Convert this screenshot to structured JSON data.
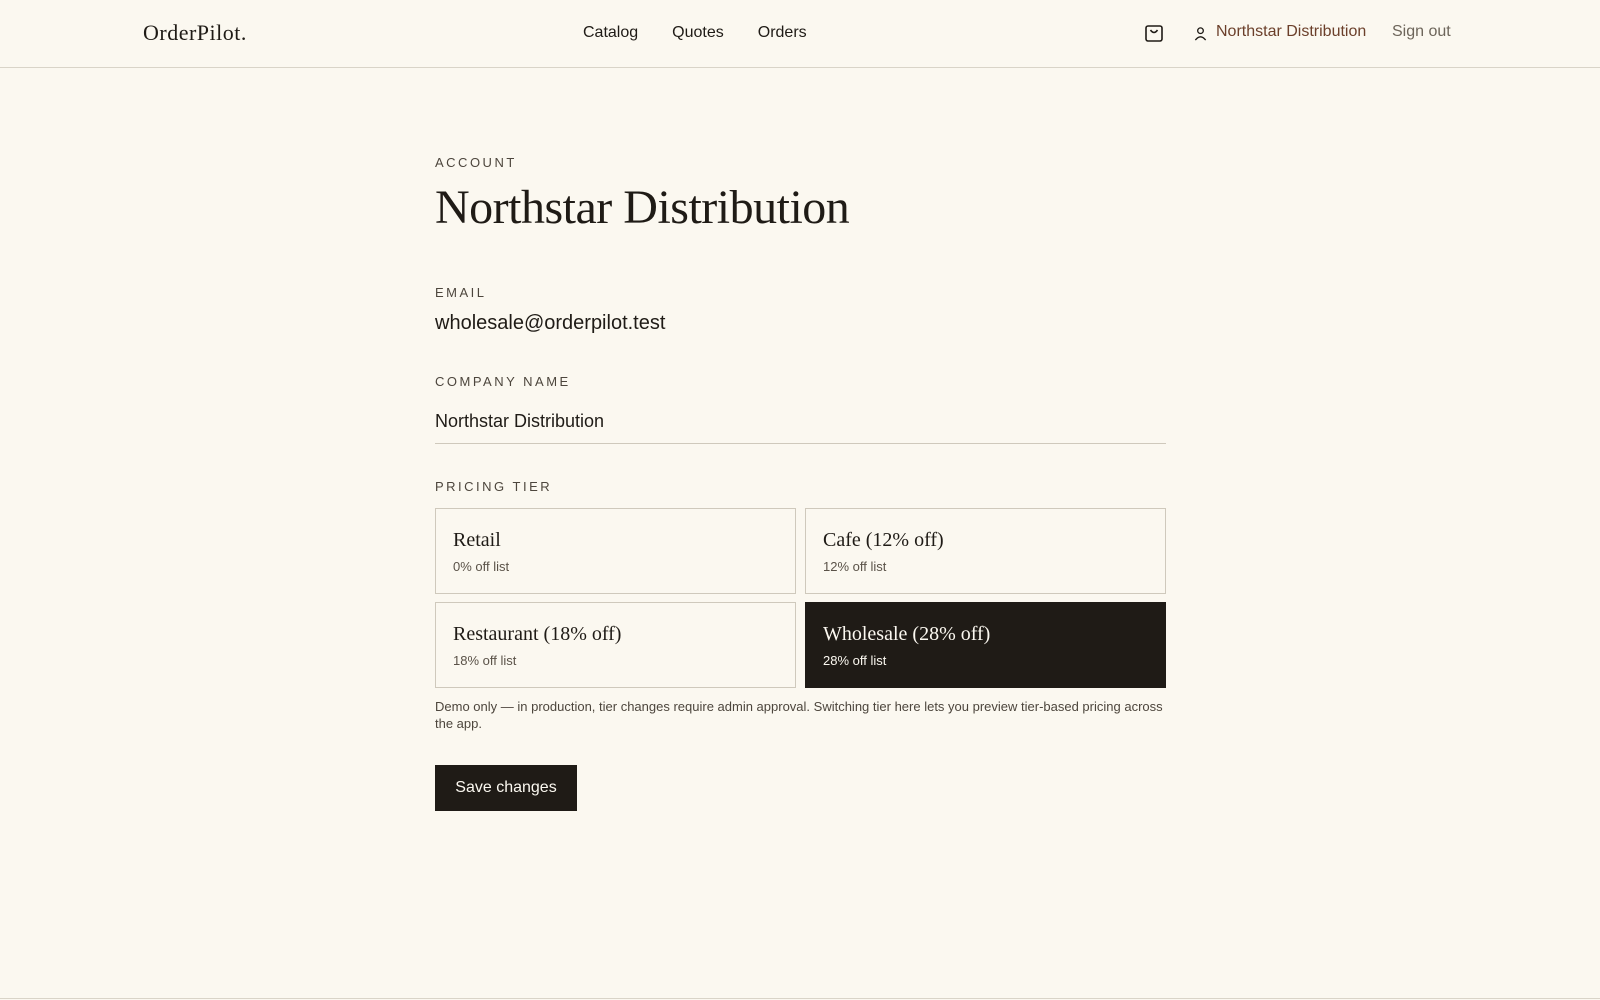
{
  "header": {
    "logo": "OrderPilot.",
    "nav": [
      "Catalog",
      "Quotes",
      "Orders"
    ],
    "cart_icon": "shopping-bag-icon",
    "account_icon": "user-icon",
    "account_name": "Northstar Distribution",
    "signout_label": "Sign out"
  },
  "account": {
    "eyebrow": "ACCOUNT",
    "title": "Northstar Distribution",
    "email_label": "EMAIL",
    "email": "wholesale@orderpilot.test",
    "company_label": "COMPANY NAME",
    "company_value": "Northstar Distribution",
    "tier_label": "PRICING TIER",
    "tiers": [
      {
        "name": "Retail",
        "sub": "0% off list",
        "selected": false
      },
      {
        "name": "Cafe (12% off)",
        "sub": "12% off list",
        "selected": false
      },
      {
        "name": "Restaurant (18% off)",
        "sub": "18% off list",
        "selected": false
      },
      {
        "name": "Wholesale (28% off)",
        "sub": "28% off list",
        "selected": true
      }
    ],
    "note": "Demo only — in production, tier changes require admin approval. Switching tier here lets you preview tier-based pricing across the app.",
    "save_label": "Save changes"
  },
  "colors": {
    "background": "#fbf8f0",
    "ink": "#1f1b16",
    "accent": "#6b3f2a",
    "border": "#cfc9bc"
  }
}
